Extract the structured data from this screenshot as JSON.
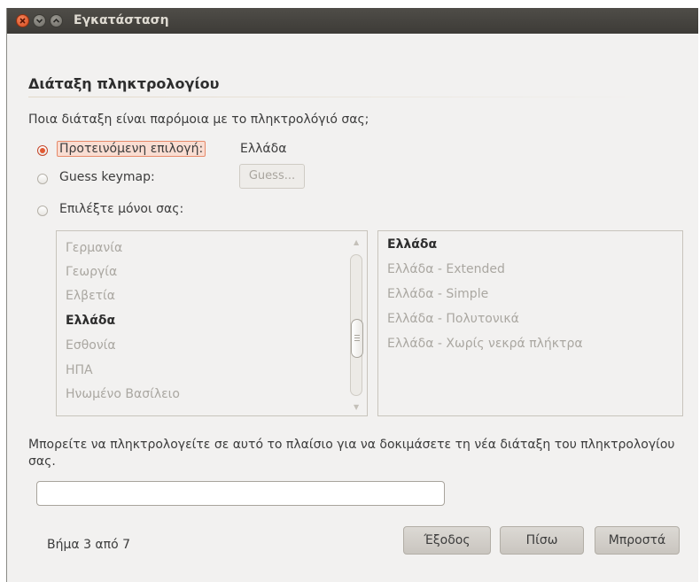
{
  "window": {
    "title": "Εγκατάσταση"
  },
  "page": {
    "heading": "Διάταξη πληκτρολογίου",
    "question": "Ποια διάταξη είναι παρόμοια με το πληκτρολόγιό σας;"
  },
  "options": {
    "suggested_label": "Προτεινόμενη επιλογή:",
    "suggested_value": "Ελλάδα",
    "guess_label": "Guess keymap:",
    "guess_button": "Guess...",
    "choose_label": "Επιλέξτε μόνοι σας:",
    "selected": "suggested"
  },
  "countries": {
    "items": [
      "Γερμανία",
      "Γεωργία",
      "Ελβετία",
      "Ελλάδα",
      "Εσθονία",
      "ΗΠΑ",
      "Ηνωμένο Βασίλειο"
    ],
    "selected": "Ελλάδα"
  },
  "variants": {
    "items": [
      "Ελλάδα",
      "Ελλάδα - Extended",
      "Ελλάδα - Simple",
      "Ελλάδα - Πολυτονικά",
      "Ελλάδα - Χωρίς νεκρά πλήκτρα"
    ],
    "selected": "Ελλάδα"
  },
  "test": {
    "hint": "Μπορείτε να πληκτρολογείτε σε αυτό το πλαίσιο για να δοκιμάσετε τη νέα διάταξη του πληκτρολογίου σας.",
    "value": ""
  },
  "footer": {
    "step": "Βήμα 3 από 7",
    "quit": "Έξοδος",
    "back": "Πίσω",
    "forward": "Μπροστά"
  },
  "colors": {
    "titlebar": "#3d3b37",
    "accent": "#e15a33",
    "window_bg": "#f2f1f0"
  }
}
